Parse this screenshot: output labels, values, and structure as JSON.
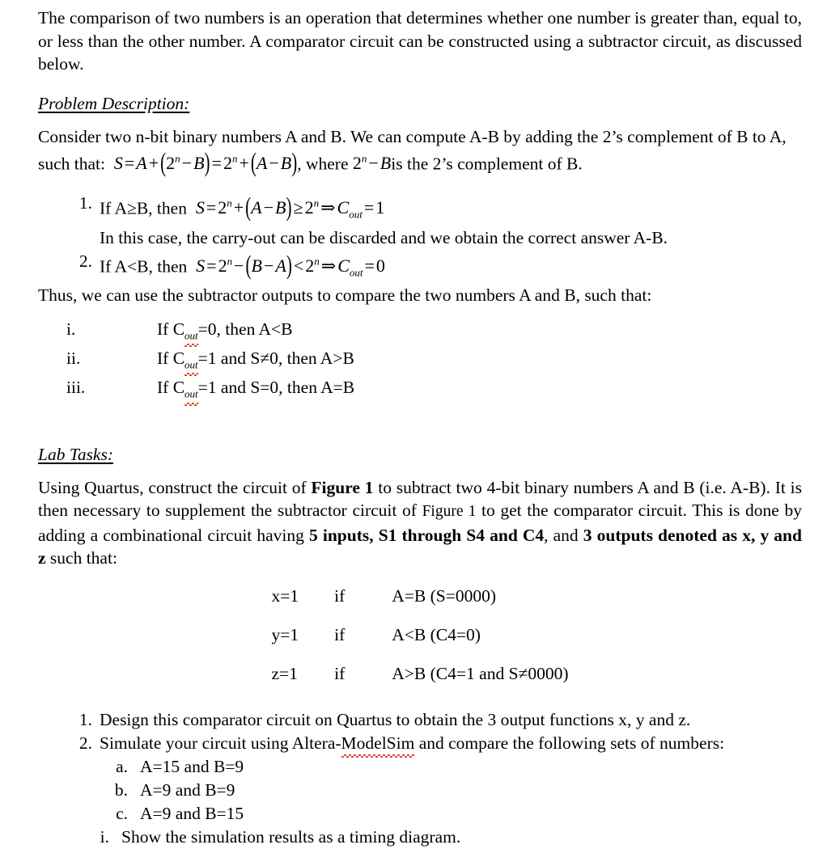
{
  "document": {
    "intro_paragraph": "The comparison of two numbers is an operation that determines whether one number is greater than, equal to, or less than the other number. A comparator circuit can be constructed using a subtractor circuit, as discussed below.",
    "problem_description": {
      "heading": "Problem Description:",
      "paragraph_lead": "Consider two n-bit binary numbers A and B. We can compute A-B by adding the 2’s complement of B to A, such that:",
      "equation": {
        "S": "S",
        "eq1": "=",
        "A": "A",
        "plus": "+",
        "open1": "(",
        "two": "2",
        "n": "n",
        "minus": "−",
        "B": "B",
        "close1": ")",
        "eq2": "=",
        "two2": "2",
        "n2": "n",
        "plus2": "+",
        "open2": "(",
        "A2": "A",
        "minus2": "−",
        "B2": "B",
        "close2": ")",
        "comma": ","
      },
      "paragraph_tail_1": "where",
      "inline_math_tail": {
        "two": "2",
        "n": "n",
        "minus": "−",
        "B": "B"
      },
      "paragraph_tail_2": "is the 2’s complement of B.",
      "cases": [
        {
          "marker": "1.",
          "lead": "If A≥B, then",
          "math": {
            "S": "S",
            "eq": "=",
            "two": "2",
            "n": "n",
            "plus": "+",
            "open": "(",
            "A": "A",
            "minus": "−",
            "B": "B",
            "close": ")",
            "rel": "≥",
            "two2": "2",
            "n2": "n",
            "implies": "⇒",
            "C": "C",
            "outsub": "out",
            "eq2": "=",
            "val": "1"
          },
          "note": "In this case, the carry-out can be discarded and we obtain the correct answer A-B."
        },
        {
          "marker": "2.",
          "lead": "If A<B, then",
          "math": {
            "S": "S",
            "eq": "=",
            "two": "2",
            "n": "n",
            "plus": "−",
            "open": "(",
            "A": "B",
            "minus": "−",
            "B": "A",
            "close": ")",
            "rel": "<",
            "two2": "2",
            "n2": "n",
            "implies": "⇒",
            "C": "C",
            "outsub": "out",
            "eq2": "=",
            "val": "0"
          },
          "note": ""
        }
      ],
      "thus_line": "Thus, we can use the subtractor outputs to compare the two numbers A and B, such that:",
      "conditions": [
        {
          "marker": "i.",
          "pre": "If C",
          "sub": "out",
          "post": "=0, then A<B"
        },
        {
          "marker": "ii.",
          "pre": "If C",
          "sub": "out",
          "post": "=1 and S≠0, then A>B"
        },
        {
          "marker": "iii.",
          "pre": "If C",
          "sub": "out",
          "post": "=1 and S=0, then A=B"
        }
      ]
    },
    "lab_tasks": {
      "heading": "Lab Tasks:",
      "paragraph": {
        "p1": "Using Quartus, construct the circuit of ",
        "fig_bold": "Figure 1",
        "p2": " to subtract two 4-bit binary numbers A and B (i.e. A-B). It is then necessary to supplement the subtractor circuit of ",
        "fig_plain": "Figure 1",
        "p3": " to get the comparator circuit. This is done by adding a combinational circuit having ",
        "bold1": "5 inputs, S1 through S4 and C4",
        "p4": ", and ",
        "bold2": "3 outputs denoted as x, y and z",
        "p5": " such that:"
      },
      "equations": [
        {
          "lhs": "x=1",
          "mid": "if",
          "rhs": "A=B (S=0000)"
        },
        {
          "lhs": "y=1",
          "mid": "if",
          "rhs": "A<B (C4=0)"
        },
        {
          "lhs": "z=1",
          "mid": "if",
          "rhs": "A>B (C4=1 and S≠0000)"
        }
      ],
      "tasks": [
        {
          "marker": "1.",
          "text": "Design this comparator circuit on Quartus to obtain the 3 output functions x, y and z."
        },
        {
          "marker": "2.",
          "text_pre": "Simulate your circuit using Altera-",
          "misspelled": "ModelSim",
          "text_post": " and compare the following sets of numbers:"
        }
      ],
      "sub_tasks": [
        {
          "marker": "a.",
          "text": "A=15 and B=9"
        },
        {
          "marker": "b.",
          "text": "A=9 and B=9"
        },
        {
          "marker": "c.",
          "text": "A=9 and B=15"
        }
      ],
      "final_task": {
        "marker": "i.",
        "text": "Show the simulation results as a timing diagram."
      }
    },
    "colors": {
      "text": "#000000",
      "background": "#ffffff",
      "spellcheck_underline": "#e02b16"
    }
  }
}
